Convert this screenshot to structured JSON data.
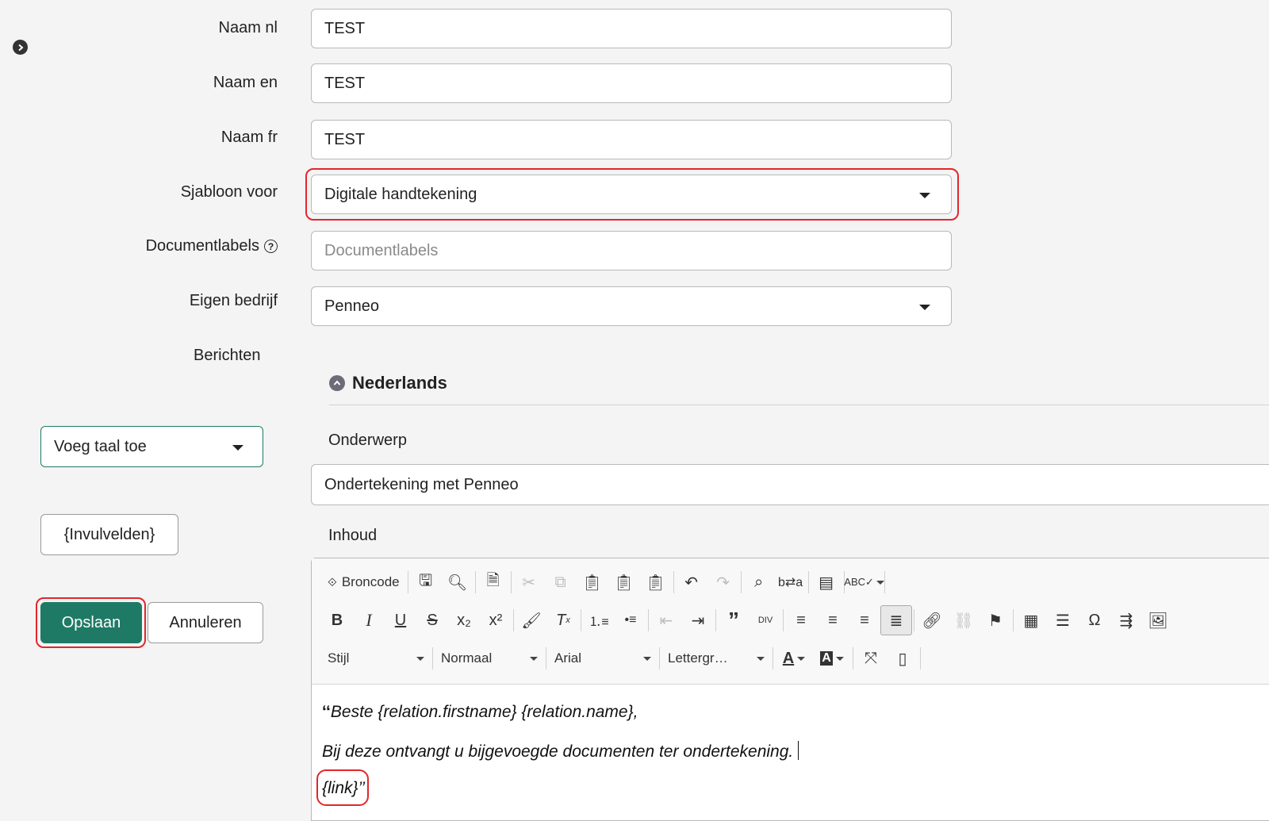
{
  "form": {
    "naam_nl": {
      "label": "Naam nl",
      "value": "TEST"
    },
    "naam_en": {
      "label": "Naam en",
      "value": "TEST"
    },
    "naam_fr": {
      "label": "Naam fr",
      "value": "TEST"
    },
    "sjabloon": {
      "label": "Sjabloon voor",
      "value": "Digitale handtekening"
    },
    "documentlabels": {
      "label": "Documentlabels",
      "placeholder": "Documentlabels",
      "help_icon": "question-circle-icon"
    },
    "eigen_bedrijf": {
      "label": "Eigen bedrijf",
      "value": "Penneo"
    },
    "berichten_label": "Berichten"
  },
  "left_panel": {
    "expand_icon": "chevron-circle-right-icon",
    "add_language": "Voeg taal toe",
    "fields_button": "{Invulvelden}",
    "save_button": "Opslaan",
    "cancel_button": "Annuleren"
  },
  "message": {
    "language_title": "Nederlands",
    "collapse_icon": "chevron-circle-up-icon",
    "subject_label": "Onderwerp",
    "subject_value": "Ondertekening met Penneo",
    "content_label": "Inhoud"
  },
  "toolbar": {
    "source_label": "Broncode",
    "style_combo": "Stijl",
    "format_combo": "Normaal",
    "font_combo": "Arial",
    "size_combo": "Lettergr…"
  },
  "editor": {
    "line1": "Beste {relation.firstname} {relation.name},",
    "line1_open_quote": "‘‘",
    "line2": "Bij deze ontvangt u bijgevoegde documenten ter ondertekening.",
    "line3": "{link}",
    "line3_close_quote": "’’"
  },
  "colors": {
    "primary": "#1f7a65",
    "highlight": "#e3262b",
    "input_border": "#b9b9b9"
  }
}
